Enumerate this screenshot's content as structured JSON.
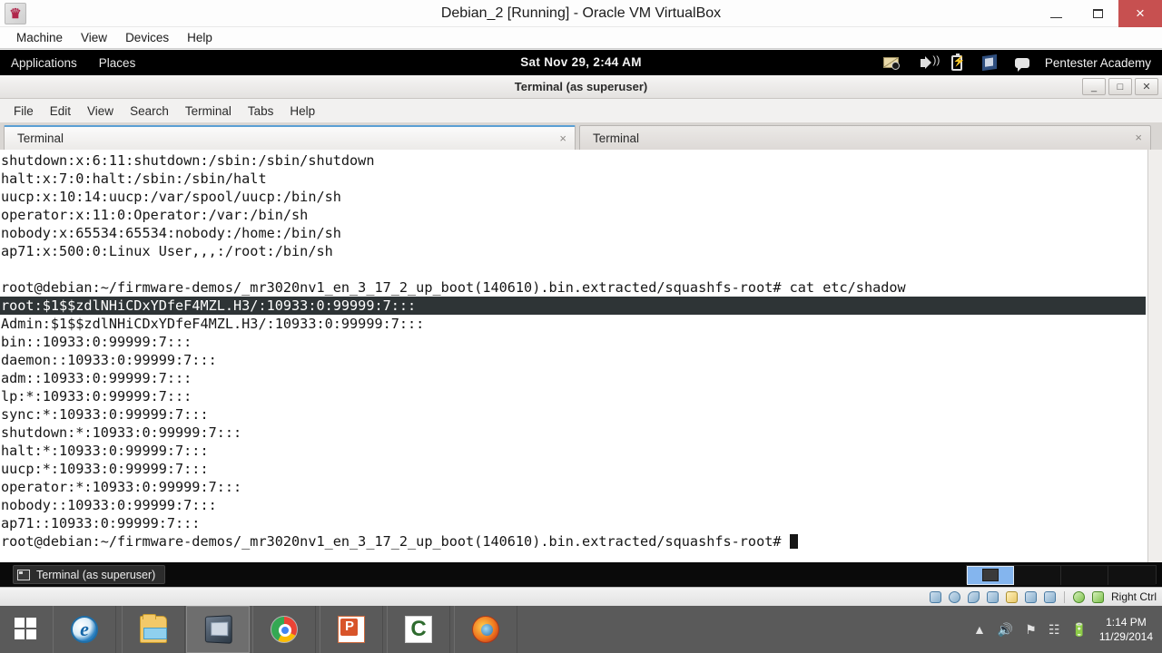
{
  "vbox": {
    "title": "Debian_2 [Running] - Oracle VM VirtualBox",
    "app_icon": "virtualbox-icon",
    "window_buttons": {
      "minimize": "minimize-icon",
      "restore": "restore-icon",
      "close": "×"
    },
    "menus": [
      "Machine",
      "View",
      "Devices",
      "Help"
    ],
    "status": {
      "icons": [
        "hard-disk-icon",
        "optical-disk-icon",
        "usb-icon",
        "network-icon",
        "shared-folders-icon",
        "display-icon",
        "virtualbox-logo-icon",
        "mouse-capture-icon",
        "keyboard-capture-icon"
      ],
      "host_key": "Right Ctrl"
    }
  },
  "gnome_panel": {
    "menus": [
      "Applications",
      "Places"
    ],
    "clock": "Sat Nov 29,  2:44 AM",
    "tray_icons": [
      "mail-icon",
      "volume-icon",
      "battery-icon",
      "network-icon",
      "chat-icon"
    ],
    "user": "Pentester Academy"
  },
  "terminal": {
    "title": "Terminal (as superuser)",
    "window_buttons": {
      "minimize": "_",
      "maximize": "□",
      "close": "✕"
    },
    "menus": [
      "File",
      "Edit",
      "View",
      "Search",
      "Terminal",
      "Tabs",
      "Help"
    ],
    "tabs": [
      {
        "label": "Terminal",
        "close": "×",
        "active": true
      },
      {
        "label": "Terminal",
        "close": "×",
        "active": false
      }
    ],
    "lines": [
      {
        "text": "shutdown:x:6:11:shutdown:/sbin:/sbin/shutdown",
        "selected": false
      },
      {
        "text": "halt:x:7:0:halt:/sbin:/sbin/halt",
        "selected": false
      },
      {
        "text": "uucp:x:10:14:uucp:/var/spool/uucp:/bin/sh",
        "selected": false
      },
      {
        "text": "operator:x:11:0:Operator:/var:/bin/sh",
        "selected": false
      },
      {
        "text": "nobody:x:65534:65534:nobody:/home:/bin/sh",
        "selected": false
      },
      {
        "text": "ap71:x:500:0:Linux User,,,:/root:/bin/sh",
        "selected": false
      },
      {
        "text": "",
        "selected": false
      },
      {
        "text": "root@debian:~/firmware-demos/_mr3020nv1_en_3_17_2_up_boot(140610).bin.extracted/squashfs-root# cat etc/shadow",
        "selected": false
      },
      {
        "text": "root:$1$$zdlNHiCDxYDfeF4MZL.H3/:10933:0:99999:7:::",
        "selected": true
      },
      {
        "text": "Admin:$1$$zdlNHiCDxYDfeF4MZL.H3/:10933:0:99999:7:::",
        "selected": false
      },
      {
        "text": "bin::10933:0:99999:7:::",
        "selected": false
      },
      {
        "text": "daemon::10933:0:99999:7:::",
        "selected": false
      },
      {
        "text": "adm::10933:0:99999:7:::",
        "selected": false
      },
      {
        "text": "lp:*:10933:0:99999:7:::",
        "selected": false
      },
      {
        "text": "sync:*:10933:0:99999:7:::",
        "selected": false
      },
      {
        "text": "shutdown:*:10933:0:99999:7:::",
        "selected": false
      },
      {
        "text": "halt:*:10933:0:99999:7:::",
        "selected": false
      },
      {
        "text": "uucp:*:10933:0:99999:7:::",
        "selected": false
      },
      {
        "text": "operator:*:10933:0:99999:7:::",
        "selected": false
      },
      {
        "text": "nobody::10933:0:99999:7:::",
        "selected": false
      },
      {
        "text": "ap71::10933:0:99999:7:::",
        "selected": false
      }
    ],
    "prompt": "root@debian:~/firmware-demos/_mr3020nv1_en_3_17_2_up_boot(140610).bin.extracted/squashfs-root# "
  },
  "gnome_taskbar": {
    "window_button": "Terminal (as superuser)",
    "workspaces": [
      {
        "active": true
      },
      {
        "active": false
      },
      {
        "active": false
      },
      {
        "active": false
      }
    ]
  },
  "windows_taskbar": {
    "start": "start-button",
    "apps": [
      {
        "name": "internet-explorer",
        "class": "ic-ie",
        "active": false
      },
      {
        "name": "file-explorer",
        "class": "ic-exp",
        "active": false
      },
      {
        "name": "virtualbox",
        "class": "ic-vbox",
        "active": true
      },
      {
        "name": "google-chrome",
        "class": "ic-chrome",
        "active": false
      },
      {
        "name": "powerpoint",
        "class": "ic-ppt",
        "active": false
      },
      {
        "name": "camtasia",
        "class": "ic-cam",
        "active": false
      },
      {
        "name": "firefox",
        "class": "ic-ff",
        "active": false
      }
    ],
    "tray": [
      "show-hidden-icons",
      "volume-icon",
      "network-flag-icon",
      "signal-icon",
      "battery-icon"
    ],
    "time": "1:14 PM",
    "date": "11/29/2014"
  },
  "colors": {
    "accent_blue": "#5a9fd4",
    "selection_bg": "#2e3436",
    "close_red": "#c75050",
    "taskbar_gray": "#5a5a5a"
  }
}
